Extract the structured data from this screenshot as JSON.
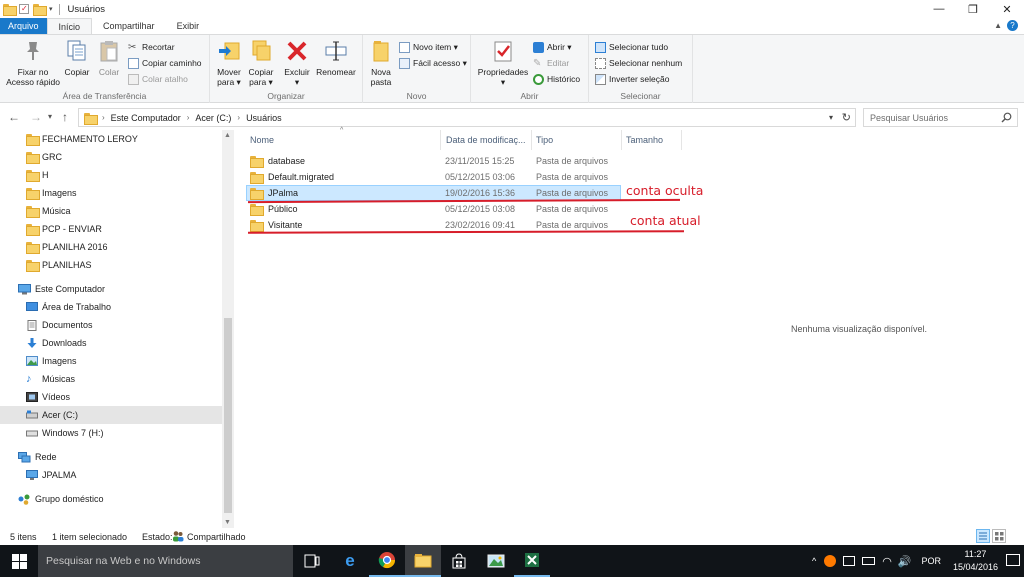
{
  "window": {
    "title": "Usuários",
    "minimize_glyph": "—",
    "restore_glyph": "❐",
    "close_glyph": "✕"
  },
  "tabs": [
    "Arquivo",
    "Início",
    "Compartilhar",
    "Exibir"
  ],
  "ribbon": {
    "clipboard": {
      "pin": "Fixar no\nAcesso rápido",
      "copy": "Copiar",
      "paste": "Colar",
      "cut": "Recortar",
      "copy_path": "Copiar caminho",
      "paste_shortcut": "Colar atalho",
      "label": "Área de Transferência"
    },
    "organize": {
      "move": "Mover\npara ▾",
      "copy_to": "Copiar\npara ▾",
      "delete": "Excluir\n▾",
      "rename": "Renomear",
      "label": "Organizar"
    },
    "new": {
      "new_folder": "Nova\npasta",
      "new_item": "Novo item ▾",
      "easy_access": "Fácil acesso ▾",
      "label": "Novo"
    },
    "open": {
      "properties": "Propriedades\n▾",
      "open": "Abrir ▾",
      "edit": "Editar",
      "history": "Histórico",
      "label": "Abrir"
    },
    "select": {
      "select_all": "Selecionar tudo",
      "select_none": "Selecionar nenhum",
      "invert": "Inverter seleção",
      "label": "Selecionar"
    }
  },
  "address": {
    "segments": [
      "Este Computador",
      "Acer (C:)",
      "Usuários"
    ],
    "search_placeholder": "Pesquisar Usuários"
  },
  "nav": {
    "quick_folders": [
      "FECHAMENTO LEROY",
      "GRC",
      "H",
      "Imagens",
      "Música",
      "PCP - ENVIAR",
      "PLANILHA 2016",
      "PLANILHAS"
    ],
    "this_pc": "Este Computador",
    "pc_items": [
      "Área de Trabalho",
      "Documentos",
      "Downloads",
      "Imagens",
      "Músicas",
      "Vídeos",
      "Acer (C:)",
      "Windows 7  (H:)"
    ],
    "network": "Rede",
    "network_items": [
      "JPALMA"
    ],
    "homegroup": "Grupo doméstico"
  },
  "columns": {
    "name": "Nome",
    "date": "Data de modificaç...",
    "type": "Tipo",
    "size": "Tamanho"
  },
  "files": [
    {
      "name": "database",
      "date": "23/11/2015 15:25",
      "type": "Pasta de arquivos"
    },
    {
      "name": "Default.migrated",
      "date": "05/12/2015 03:06",
      "type": "Pasta de arquivos"
    },
    {
      "name": "JPalma",
      "date": "19/02/2016 15:36",
      "type": "Pasta de arquivos"
    },
    {
      "name": "Público",
      "date": "05/12/2015 03:08",
      "type": "Pasta de arquivos"
    },
    {
      "name": "Visitante",
      "date": "23/02/2016 09:41",
      "type": "Pasta de arquivos"
    }
  ],
  "selected_file_index": 2,
  "annotations": {
    "hidden": "conta oculta",
    "current": "conta atual",
    "color": "#d71d2a"
  },
  "preview": "Nenhuma visualização disponível.",
  "status": {
    "count": "5 itens",
    "selected": "1 item selecionado",
    "state_label": "Estado:",
    "state_value": "Compartilhado"
  },
  "taskbar": {
    "search_placeholder": "Pesquisar na Web e no Windows",
    "language": "POR",
    "time": "11:27",
    "date": "15/04/2016"
  },
  "colors": {
    "accent": "#1979ca",
    "selection": "#cce8ff",
    "taskbar": "#101418"
  }
}
